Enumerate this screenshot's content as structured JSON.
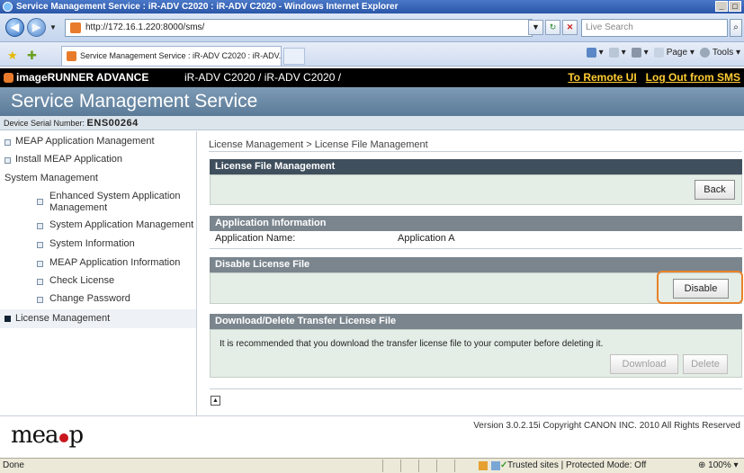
{
  "window": {
    "title": "Service Management Service : iR-ADV C2020 : iR-ADV C2020 - Windows Internet Explorer",
    "buttons": [
      "_",
      "□"
    ]
  },
  "browser": {
    "back_icon": "back-arrow-icon",
    "forward_icon": "forward-arrow-icon",
    "url": "http://172.16.1.220:8000/sms/",
    "search_placeholder": "Live Search",
    "tab_title": "Service Management Service : iR-ADV C2020 : iR-ADV...",
    "cmd": {
      "page": "Page ▾",
      "tools": "Tools ▾"
    }
  },
  "header": {
    "brand": "imageRUNNER ADVANCE",
    "model": "iR-ADV C2020 / iR-ADV C2020 /",
    "link_remote": "To Remote UI",
    "link_logout": "Log Out from SMS"
  },
  "service_title": "Service Management Service",
  "serial": {
    "label": "Device Serial Number:",
    "value": "ENS00264"
  },
  "sidebar": {
    "items": [
      {
        "label": "MEAP Application Management"
      },
      {
        "label": "Install MEAP Application"
      },
      {
        "label": "System Management"
      },
      {
        "label": "Enhanced System Application Management"
      },
      {
        "label": "System Application Management"
      },
      {
        "label": "System Information"
      },
      {
        "label": "MEAP Application Information"
      },
      {
        "label": "Check License"
      },
      {
        "label": "Change Password"
      },
      {
        "label": "License Management"
      }
    ]
  },
  "main": {
    "breadcrumb": "License Management > License File Management",
    "section1": {
      "title": "License File Management",
      "back": "Back"
    },
    "section2": {
      "title": "Application Information",
      "name_label": "Application Name:",
      "name_value": "Application A"
    },
    "section3": {
      "title": "Disable License File",
      "disable": "Disable"
    },
    "section4": {
      "title": "Download/Delete Transfer License File",
      "message": "It is recommended that you download the transfer license file to your computer before deleting it.",
      "download": "Download",
      "delete": "Delete"
    }
  },
  "footer": {
    "logo": "meap",
    "copyright": "Version 3.0.2.15i Copyright CANON INC. 2010 All Rights Reserved"
  },
  "status": {
    "left": "Done",
    "zone": "Trusted sites | Protected Mode: Off",
    "zoom": "100%"
  },
  "colors": {
    "accent_header": "#3f4f5d",
    "highlight": "#e8822a",
    "title_band": "#6a8aa6"
  }
}
